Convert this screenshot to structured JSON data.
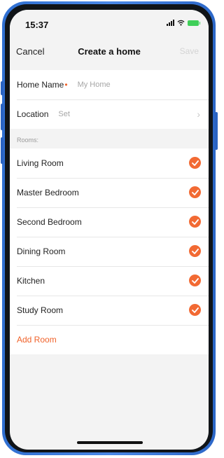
{
  "status_bar": {
    "time": "15:37"
  },
  "nav": {
    "cancel_label": "Cancel",
    "title": "Create a home",
    "save_label": "Save"
  },
  "form": {
    "home_name_label": "Home Name",
    "home_name_required_mark": "•",
    "home_name_placeholder": "My Home",
    "location_label": "Location",
    "location_value": "Set"
  },
  "rooms": {
    "section_title": "Rooms:",
    "items": [
      {
        "label": "Living Room",
        "checked": true
      },
      {
        "label": "Master Bedroom",
        "checked": true
      },
      {
        "label": "Second Bedroom",
        "checked": true
      },
      {
        "label": "Dining Room",
        "checked": true
      },
      {
        "label": "Kitchen",
        "checked": true
      },
      {
        "label": "Study Room",
        "checked": true
      }
    ],
    "add_room_label": "Add Room"
  },
  "colors": {
    "accent": "#f26a33",
    "phone_frame": "#3b7bde",
    "background": "#f3f3f3",
    "disabled_text": "#d4d4d4"
  },
  "icons": {
    "room_check": "checkmark-circle-icon",
    "location_chevron": "chevron-right-icon",
    "signal": "signal-icon",
    "wifi": "wifi-icon",
    "battery": "battery-icon"
  }
}
